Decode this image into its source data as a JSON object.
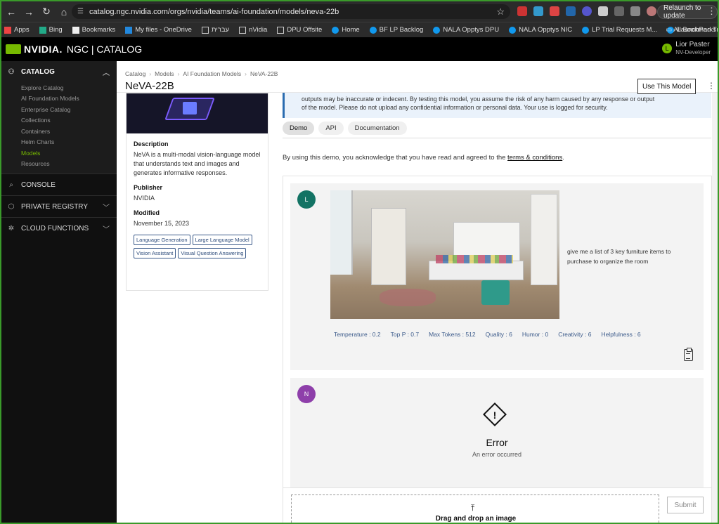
{
  "browser": {
    "url": "catalog.ngc.nvidia.com/orgs/nvidia/teams/ai-foundation/models/neva-22b",
    "relaunch_label": "Relaunch to update",
    "bookmarks": [
      "Apps",
      "Bing",
      "Bookmarks",
      "My files - OneDrive",
      "עברית",
      "nVidia",
      "DPU Offsite",
      "Home",
      "BF LP Backlog",
      "NALA Opptys DPU",
      "NALA Opptys NIC",
      "LP Trial Requests M...",
      "LaunchPad Trial (For..."
    ],
    "bookmarks_more": "»",
    "all_bookmarks": "All Bookmarks"
  },
  "header": {
    "brand": "NVIDIA.",
    "product": "NGC | CATALOG",
    "user_initial": "L",
    "user_name": "Lior Paster",
    "user_role": "NV-Developer"
  },
  "sidebar": {
    "catalog": "CATALOG",
    "items": [
      "Explore Catalog",
      "AI Foundation Models",
      "Enterprise Catalog",
      "Collections",
      "Containers",
      "Helm Charts",
      "Models",
      "Resources"
    ],
    "active_index": 6,
    "console": "CONSOLE",
    "private_registry": "PRIVATE REGISTRY",
    "cloud_functions": "CLOUD FUNCTIONS"
  },
  "page": {
    "breadcrumbs": [
      "Catalog",
      "Models",
      "AI Foundation Models",
      "NeVA-22B"
    ],
    "title": "NeVA-22B",
    "use_button": "Use This Model"
  },
  "card": {
    "description_label": "Description",
    "description": "NeVA is a multi-modal vision-language model that understands text and images and generates informative responses.",
    "publisher_label": "Publisher",
    "publisher": "NVIDIA",
    "modified_label": "Modified",
    "modified": "November 15, 2023",
    "tags": [
      "Language Generation",
      "Large Language Model",
      "Vision Assistant",
      "Visual Question Answering"
    ]
  },
  "warning": {
    "line1": "outputs may be inaccurate or indecent. By testing this model, you assume the risk of any harm caused by any response or output",
    "line2": "of the model. Please do not upload any confidential information or personal data. Your use is logged for security."
  },
  "tabs": [
    "Demo",
    "API",
    "Documentation"
  ],
  "agreement": {
    "text": "By using this demo, you acknowledge that you have read and agreed to the ",
    "link": "terms & conditions",
    "end": "."
  },
  "chat": {
    "user_initial": "L",
    "prompt": "give me a list of 3 key furniture items to purchase to organize the room",
    "params": [
      "Temperature : 0.2",
      "Top P : 0.7",
      "Max Tokens : 512",
      "Quality : 6",
      "Humor : 0",
      "Creativity : 6",
      "Helpfulness : 6"
    ],
    "bot_initial": "N",
    "error_title": "Error",
    "error_sub": "An error occurred",
    "drop_text": "Drag and drop an image",
    "submit": "Submit"
  },
  "colors": {
    "nvidia_green": "#76b900",
    "user_avatar": "#137364",
    "bot_avatar": "#8e3faa"
  }
}
